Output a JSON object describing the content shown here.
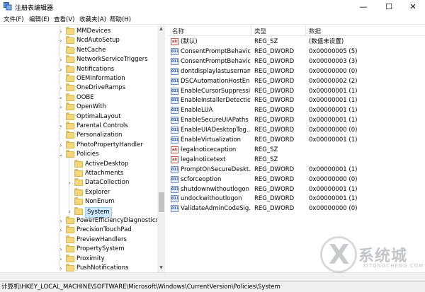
{
  "window": {
    "title": "注册表编辑器",
    "icons": {
      "app": "regedit-icon",
      "minimize": "minimize-icon",
      "maximize": "maximize-icon",
      "close": "close-icon"
    },
    "min_glyph": "—",
    "max_glyph": "☐",
    "close_glyph": "✕"
  },
  "menu": {
    "items": [
      "文件(F)",
      "编辑(E)",
      "查看(V)",
      "收藏夹(A)",
      "帮助(H)"
    ]
  },
  "tree": {
    "items": [
      {
        "label": "MMDevices",
        "expander": "›"
      },
      {
        "label": "NcdAutoSetup",
        "expander": "›"
      },
      {
        "label": "NetCache",
        "expander": ""
      },
      {
        "label": "NetworkServiceTriggers",
        "expander": "›"
      },
      {
        "label": "Notifications",
        "expander": "›"
      },
      {
        "label": "OEMInformation",
        "expander": ""
      },
      {
        "label": "OneDriveRamps",
        "expander": "›"
      },
      {
        "label": "OOBE",
        "expander": "›"
      },
      {
        "label": "OpenWith",
        "expander": "›"
      },
      {
        "label": "OptimalLayout",
        "expander": ""
      },
      {
        "label": "Parental Controls",
        "expander": "›"
      },
      {
        "label": "Personalization",
        "expander": ""
      },
      {
        "label": "PhotoPropertyHandler",
        "expander": "›"
      },
      {
        "label": "Policies",
        "expander": "⌄"
      },
      {
        "label": "ActiveDesktop",
        "expander": ""
      },
      {
        "label": "Attachments",
        "expander": ""
      },
      {
        "label": "DataCollection",
        "expander": "›"
      },
      {
        "label": "Explorer",
        "expander": ""
      },
      {
        "label": "NonEnum",
        "expander": ""
      },
      {
        "label": "System",
        "expander": "›"
      },
      {
        "label": "PowerEfficiencyDiagnostics",
        "expander": "›"
      },
      {
        "label": "PrecisionTouchPad",
        "expander": "›"
      },
      {
        "label": "PreviewHandlers",
        "expander": ""
      },
      {
        "label": "PropertySystem",
        "expander": "›"
      },
      {
        "label": "Proximity",
        "expander": "›"
      },
      {
        "label": "PushNotifications",
        "expander": "›"
      }
    ],
    "selected": "System"
  },
  "list": {
    "columns": {
      "name": "名称",
      "type": "类型",
      "data": "数据"
    },
    "rows": [
      {
        "name": "(默认)",
        "type": "REG_SZ",
        "data": "(数值未设置)",
        "kind": "sz"
      },
      {
        "name": "ConsentPromptBehavio...",
        "type": "REG_DWORD",
        "data": "0x00000005 (5)",
        "kind": "dword"
      },
      {
        "name": "ConsentPromptBehavio...",
        "type": "REG_DWORD",
        "data": "0x00000003 (3)",
        "kind": "dword"
      },
      {
        "name": "dontdisplaylastusername",
        "type": "REG_DWORD",
        "data": "0x00000000 (0)",
        "kind": "dword"
      },
      {
        "name": "DSCAutomationHostEn...",
        "type": "REG_DWORD",
        "data": "0x00000002 (2)",
        "kind": "dword"
      },
      {
        "name": "EnableCursorSuppressi...",
        "type": "REG_DWORD",
        "data": "0x00000001 (1)",
        "kind": "dword"
      },
      {
        "name": "EnableInstallerDetection",
        "type": "REG_DWORD",
        "data": "0x00000001 (1)",
        "kind": "dword"
      },
      {
        "name": "EnableLUA",
        "type": "REG_DWORD",
        "data": "0x00000001 (1)",
        "kind": "dword"
      },
      {
        "name": "EnableSecureUIAPaths",
        "type": "REG_DWORD",
        "data": "0x00000001 (1)",
        "kind": "dword"
      },
      {
        "name": "EnableUIADesktopTog...",
        "type": "REG_DWORD",
        "data": "0x00000000 (0)",
        "kind": "dword"
      },
      {
        "name": "EnableVirtualization",
        "type": "REG_DWORD",
        "data": "0x00000001 (1)",
        "kind": "dword"
      },
      {
        "name": "legalnoticecaption",
        "type": "REG_SZ",
        "data": "",
        "kind": "sz"
      },
      {
        "name": "legalnoticetext",
        "type": "REG_SZ",
        "data": "",
        "kind": "sz"
      },
      {
        "name": "PromptOnSecureDeskt...",
        "type": "REG_DWORD",
        "data": "0x00000001 (1)",
        "kind": "dword"
      },
      {
        "name": "scforceoption",
        "type": "REG_DWORD",
        "data": "0x00000000 (0)",
        "kind": "dword"
      },
      {
        "name": "shutdownwithoutlogon",
        "type": "REG_DWORD",
        "data": "0x00000001 (1)",
        "kind": "dword"
      },
      {
        "name": "undockwithoutlogon",
        "type": "REG_DWORD",
        "data": "0x00000001 (1)",
        "kind": "dword"
      },
      {
        "name": "ValidateAdminCodeSig...",
        "type": "REG_DWORD",
        "data": "0x00000000 (0)",
        "kind": "dword"
      }
    ],
    "icon_labels": {
      "sz": "ab",
      "dword": "011"
    }
  },
  "status": {
    "path": "计算机\\HKEY_LOCAL_MACHINE\\SOFTWARE\\Microsoft\\Windows\\CurrentVersion\\Policies\\System"
  },
  "watermark": {
    "mark": "X",
    "brand": "系统城",
    "site": "XITONGCHENG.COM"
  }
}
